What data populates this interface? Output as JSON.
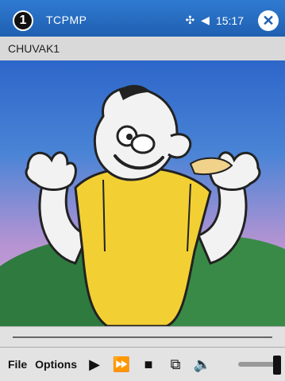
{
  "header": {
    "step_badge": "1",
    "app_name": "TCPMP",
    "time": "15:17"
  },
  "icons": {
    "signal": "signal-icon",
    "volume": "volume-icon",
    "close": "close-icon"
  },
  "content": {
    "station": "CHUVAK1"
  },
  "toolbar": {
    "file_label": "File",
    "options_label": "Options"
  },
  "colors": {
    "titlebar": "#1f5fb1",
    "shirt": "#f2d033",
    "skin": "#f2f2f2",
    "ground": "#2f7a3e"
  },
  "playback": {
    "volume_level": 0.9
  }
}
